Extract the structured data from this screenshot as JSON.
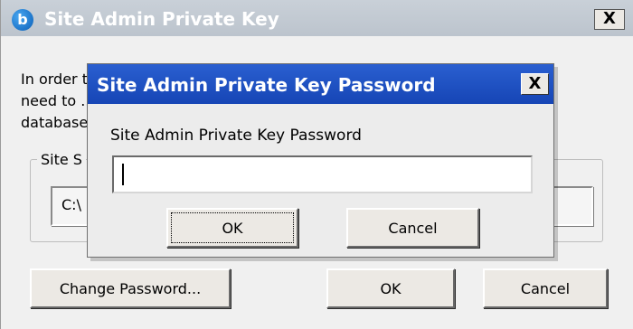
{
  "parent_window": {
    "title": "Site Admin Private Key",
    "icon": "b",
    "close_label": "X",
    "description_lines": [
      "In order to ... you",
      "need to ... the",
      "database ..."
    ],
    "group_label": "Site S",
    "path_value": "C:\\",
    "buttons": {
      "change_password": "Change Password...",
      "ok": "OK",
      "cancel": "Cancel"
    }
  },
  "modal": {
    "title": "Site Admin Private Key Password",
    "close_label": "X",
    "field_label": "Site Admin Private Key Password",
    "password_value": "",
    "buttons": {
      "ok": "OK",
      "cancel": "Cancel"
    }
  },
  "colors": {
    "modal_titlebar": "#1f53c4",
    "parent_titlebar_inactive": "#c4cbd3",
    "window_face": "#ece9e4"
  }
}
